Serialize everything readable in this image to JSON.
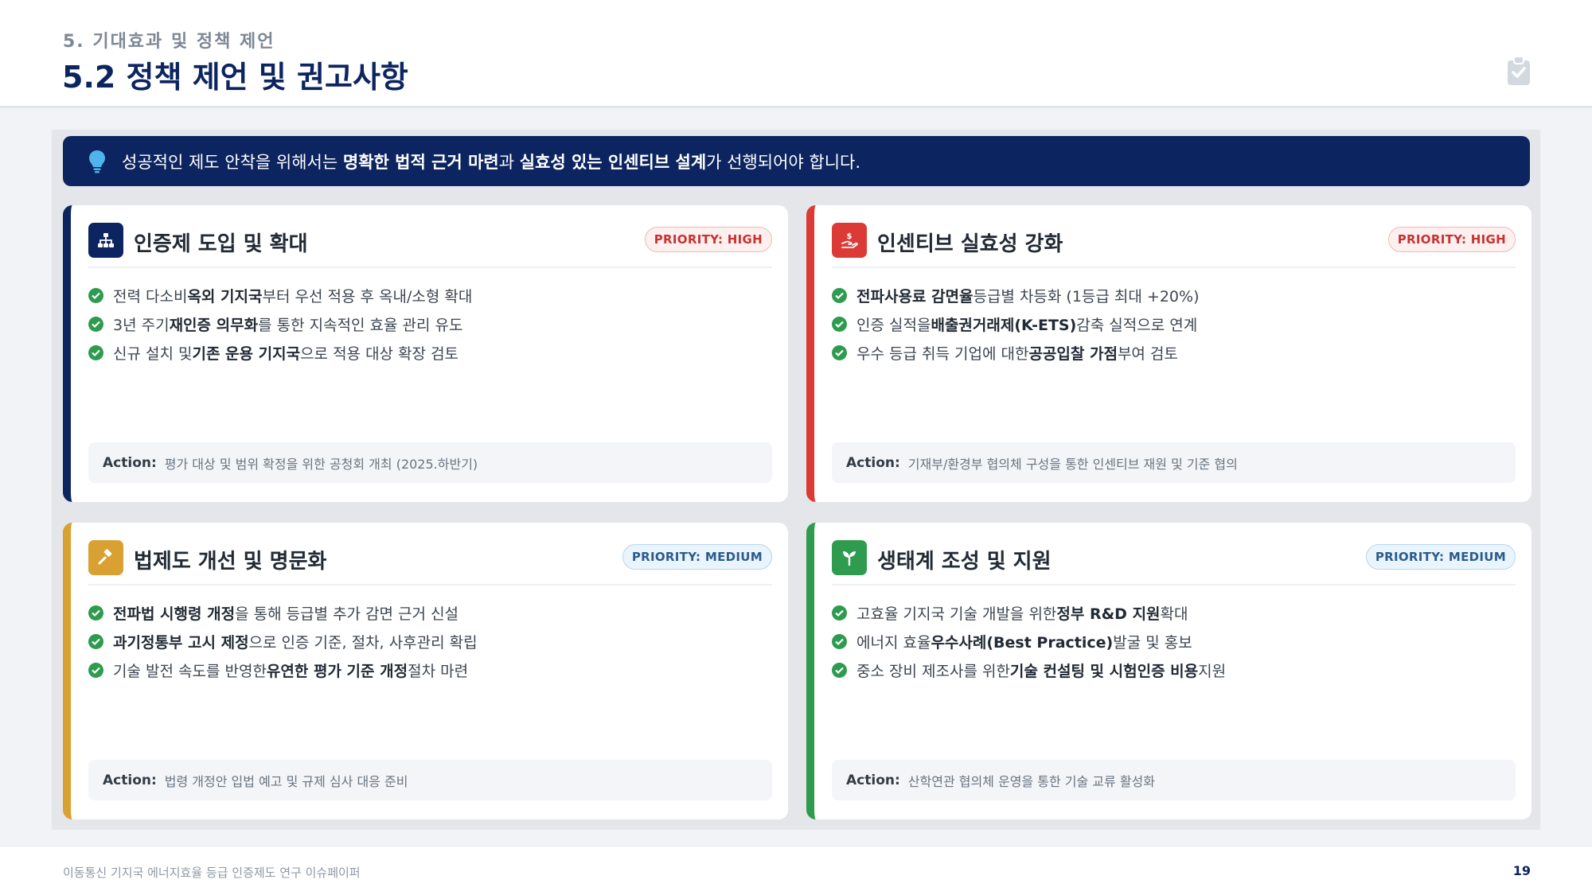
{
  "header": {
    "section_label": "5. 기대효과 및 정책 제언",
    "title": "5.2 정책 제언 및 권고사항",
    "icon": "clipboard-check-icon"
  },
  "banner": {
    "icon": "lightbulb-icon",
    "text_pre": "성공적인 제도 안착을 위해서는 ",
    "text_bold1": "명확한 법적 근거 마련",
    "text_mid": "과 ",
    "text_bold2": "실효성 있는 인센티브 설계",
    "text_post": "가 선행되어야 합니다."
  },
  "colors": {
    "navy": "#0c2460",
    "red": "#dc3a35",
    "gold": "#d9a032",
    "green": "#2e9b4e"
  },
  "cards": [
    {
      "title": "인증제 도입 및 확대",
      "icon": "sitemap-icon",
      "priority": "PRIORITY: HIGH",
      "bullets": [
        {
          "a": "전력 다소비 ",
          "b": "옥외 기지국",
          "c": "부터 우선 적용 후 옥내/소형 확대"
        },
        {
          "a": "3년 주기 ",
          "b": "재인증 의무화",
          "c": "를 통한 지속적인 효율 관리 유도"
        },
        {
          "a": "신규 설치 및 ",
          "b": "기존 운용 기지국",
          "c": "으로 적용 대상 확장 검토"
        }
      ],
      "action_label": "Action:",
      "action_text": "평가 대상 및 범위 확정을 위한 공청회 개최 (2025.하반기)"
    },
    {
      "title": "인센티브 실효성 강화",
      "icon": "hand-holding-dollar-icon",
      "priority": "PRIORITY: HIGH",
      "bullets": [
        {
          "a": "",
          "b": "전파사용료 감면율",
          "c": " 등급별 차등화 (1등급 최대 +20%)"
        },
        {
          "a": "인증 실적을 ",
          "b": "배출권거래제(K-ETS)",
          "c": " 감축 실적으로 연계"
        },
        {
          "a": "우수 등급 취득 기업에 대한 ",
          "b": "공공입찰 가점",
          "c": " 부여 검토"
        }
      ],
      "action_label": "Action:",
      "action_text": "기재부/환경부 협의체 구성을 통한 인센티브 재원 및 기준 협의"
    },
    {
      "title": "법제도 개선 및 명문화",
      "icon": "gavel-icon",
      "priority": "PRIORITY: MEDIUM",
      "bullets": [
        {
          "a": "",
          "b": "전파법 시행령 개정",
          "c": "을 통해 등급별 추가 감면 근거 신설"
        },
        {
          "a": "",
          "b": "과기정통부 고시 제정",
          "c": "으로 인증 기준, 절차, 사후관리 확립"
        },
        {
          "a": "기술 발전 속도를 반영한 ",
          "b": "유연한 평가 기준 개정",
          "c": " 절차 마련"
        }
      ],
      "action_label": "Action:",
      "action_text": "법령 개정안 입법 예고 및 규제 심사 대응 준비"
    },
    {
      "title": "생태계 조성 및 지원",
      "icon": "seedling-icon",
      "priority": "PRIORITY: MEDIUM",
      "bullets": [
        {
          "a": "고효율 기지국 기술 개발을 위한 ",
          "b": "정부 R&D 지원",
          "c": " 확대"
        },
        {
          "a": "에너지 효율 ",
          "b": "우수사례(Best Practice)",
          "c": " 발굴 및 홍보"
        },
        {
          "a": "중소 장비 제조사를 위한 ",
          "b": "기술 컨설팅 및 시험인증 비용",
          "c": " 지원"
        }
      ],
      "action_label": "Action:",
      "action_text": "산학연관 협의체 운영을 통한 기술 교류 활성화"
    }
  ],
  "footer": {
    "text": "이동통신 기지국 에너지효율 등급 인증제도 연구 이슈페이퍼",
    "page": "19"
  }
}
